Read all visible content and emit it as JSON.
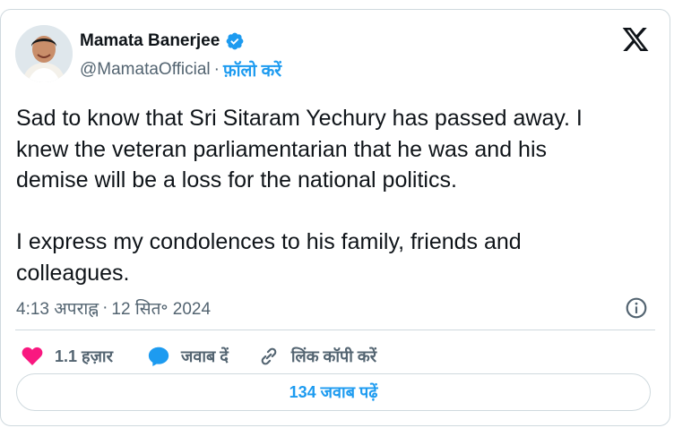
{
  "author": {
    "display_name": "Mamata Banerjee",
    "handle": "@MamataOfficial",
    "separator": "·",
    "follow_label": "फ़ॉलो करें",
    "verified": true
  },
  "tweet": {
    "text": "Sad to know that Sri Sitaram Yechury has passed away. I\nknew the veteran parliamentarian that he was and his\ndemise will be a loss for the national politics.\n\nI express my condolences to his family, friends and\ncolleagues.",
    "time": "4:13 अपराह्न",
    "separator": "·",
    "date": "12 सित॰ 2024"
  },
  "actions": {
    "like_count": "1.1 हज़ार",
    "reply_label": "जवाब दें",
    "copy_link_label": "लिंक कॉपी करें"
  },
  "read_replies_label": "134 जवाब पढ़ें",
  "colors": {
    "accent": "#1d9bf0",
    "like": "#f91880",
    "text": "#0f1419",
    "muted": "#536471",
    "border": "#cfd9de"
  },
  "icons": [
    "avatar",
    "verified-badge-icon",
    "x-logo-icon",
    "info-icon",
    "heart-icon",
    "reply-bubble-icon",
    "link-icon"
  ]
}
